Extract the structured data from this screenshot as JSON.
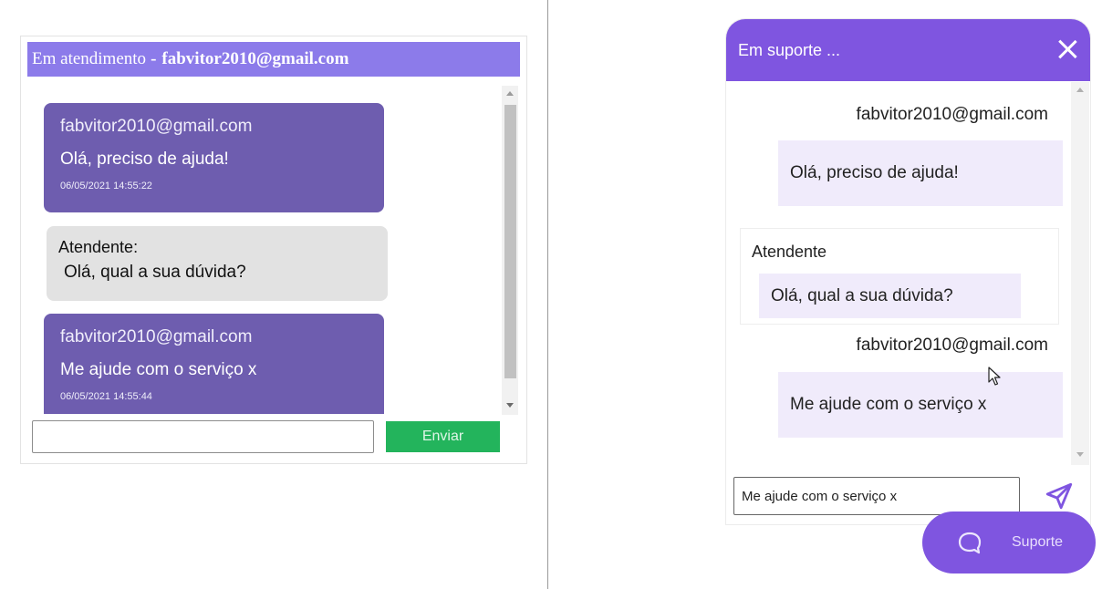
{
  "left": {
    "header": {
      "label": "Em atendimento",
      "separator": "-",
      "user": "fabvitor2010@gmail.com"
    },
    "messages": [
      {
        "sender": "fabvitor2010@gmail.com",
        "text": "Olá, preciso de ajuda!",
        "timestamp": "06/05/2021 14:55:22"
      },
      {
        "sender": "Atendente:",
        "text": "Olá, qual a sua dúvida?"
      },
      {
        "sender": "fabvitor2010@gmail.com",
        "text": "Me ajude com o serviço x",
        "timestamp": "06/05/2021 14:55:44"
      }
    ],
    "input": {
      "value": "",
      "placeholder": ""
    },
    "send_label": "Enviar"
  },
  "right": {
    "header": {
      "title": "Em suporte ...",
      "close_icon": "close-icon"
    },
    "messages": [
      {
        "sender": "fabvitor2010@gmail.com",
        "text": "Olá, preciso de ajuda!"
      },
      {
        "sender": "Atendente",
        "text": "Olá, qual a sua dúvida?"
      },
      {
        "sender": "fabvitor2010@gmail.com",
        "text": "Me ajude com o serviço x"
      }
    ],
    "input": {
      "value": "Me ajude com o serviço x"
    },
    "send_icon": "paper-plane-icon"
  },
  "support_button": {
    "label": "Suporte",
    "icon": "chat-bubble-icon"
  },
  "colors": {
    "left_header": "#8c7bea",
    "left_user_bubble": "#6e5daf",
    "left_agent_bubble": "#e2e2e2",
    "send_button": "#23b45c",
    "right_accent": "#7f55e0",
    "right_message_bg": "#f0ebfb"
  }
}
